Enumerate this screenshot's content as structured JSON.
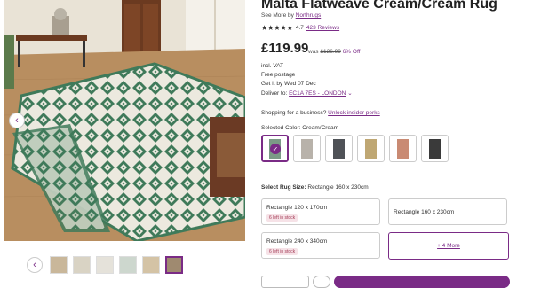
{
  "product": {
    "title": "Malta Flatweave Cream/Cream Rug",
    "see_more_prefix": "See More by",
    "brand": "Northrugs",
    "rating_stars": "★★★★★",
    "rating_value": "4.7",
    "reviews": "423 Reviews",
    "price": "£119.99",
    "was_prefix": "was",
    "was_price": "£126.99",
    "discount": "6% Off",
    "vat": "incl. VAT",
    "postage": "Free postage",
    "delivery_by": "Get it by Wed 07 Dec",
    "deliver_to_prefix": "Deliver to:",
    "deliver_to": "EC1A 7ES - LONDON",
    "business_prefix": "Shopping for a business?",
    "business_link": "Unlock insider perks"
  },
  "color": {
    "label": "Selected Color:",
    "value": "Cream/Cream",
    "swatches": [
      {
        "name": "cream-green",
        "fill": "#7b9a86"
      },
      {
        "name": "cream-grey",
        "fill": "#b8b2aa"
      },
      {
        "name": "charcoal",
        "fill": "#4f5257"
      },
      {
        "name": "cream-mustard",
        "fill": "#bfa773"
      },
      {
        "name": "terracotta",
        "fill": "#c98a73"
      },
      {
        "name": "black-white",
        "fill": "#3a3a3a"
      }
    ],
    "accent": "#7a2b86"
  },
  "size": {
    "label": "Select Rug Size:",
    "value": "Rectangle 160 x 230cm",
    "options": [
      {
        "label": "Rectangle 120 x 170cm",
        "stock": "6 left in stock"
      },
      {
        "label": "Rectangle 160 x 230cm",
        "stock": ""
      },
      {
        "label": "Rectangle 240 x 340cm",
        "stock": "6 left in stock"
      }
    ],
    "more": "+ 4 More"
  },
  "gallery": {
    "prev_icon": "‹",
    "thumb_count": 6
  }
}
